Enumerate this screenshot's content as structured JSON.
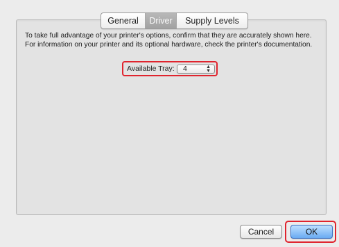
{
  "tabs": [
    {
      "label": "General",
      "selected": false
    },
    {
      "label": "Driver",
      "selected": true
    },
    {
      "label": "Supply Levels",
      "selected": false
    }
  ],
  "description": "To take full advantage of your printer's options, confirm that they are accurately shown here. For information on your printer and its optional hardware, check the printer's documentation.",
  "available_tray": {
    "label": "Available Tray:",
    "value": "4"
  },
  "buttons": {
    "cancel_label": "Cancel",
    "ok_label": "OK"
  },
  "colors": {
    "highlight": "#e0242e",
    "default_button": "#6aabf2",
    "selected_tab": "#a2a2a2"
  }
}
